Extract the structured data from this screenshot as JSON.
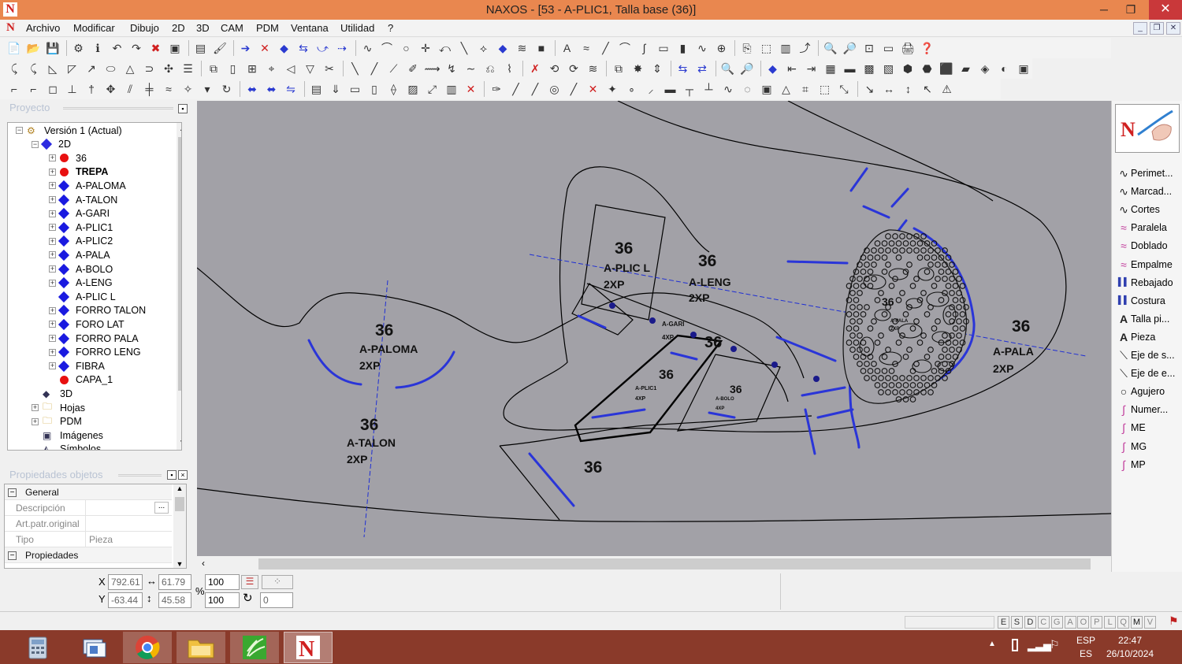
{
  "window": {
    "title": "NAXOS - [53 - A-PLIC1, Talla base (36)]",
    "logo_glyph": "N"
  },
  "menu": [
    "Archivo",
    "Modificar",
    "Dibujo",
    "2D",
    "3D",
    "CAM",
    "PDM",
    "Ventana",
    "Utilidad",
    "?"
  ],
  "panels": {
    "project_title": "Proyecto",
    "props_title": "Propiedades objetos"
  },
  "tree": [
    {
      "label": "Versión 1 (Actual)",
      "icon": "version-icon",
      "exp": "−"
    },
    {
      "label": "2D",
      "icon": "diamond-icon",
      "color": "#2d2be0",
      "exp": "−"
    },
    {
      "label": "36",
      "icon": "dot-icon",
      "color": "#e81010",
      "exp": "+"
    },
    {
      "label": "TREPA",
      "icon": "dot-icon",
      "color": "#e81010",
      "exp": "+",
      "bold": true
    },
    {
      "label": "A-PALOMA",
      "icon": "diamond-icon",
      "color": "#1a1ae0",
      "exp": "+"
    },
    {
      "label": "A-TALON",
      "icon": "diamond-icon",
      "color": "#1a1ae0",
      "exp": "+"
    },
    {
      "label": "A-GARI",
      "icon": "diamond-icon",
      "color": "#1a1ae0",
      "exp": "+"
    },
    {
      "label": "A-PLIC1",
      "icon": "diamond-icon",
      "color": "#1a1ae0",
      "exp": "+"
    },
    {
      "label": "A-PLIC2",
      "icon": "diamond-icon",
      "color": "#1a1ae0",
      "exp": "+"
    },
    {
      "label": "A-PALA",
      "icon": "diamond-icon",
      "color": "#1a1ae0",
      "exp": "+"
    },
    {
      "label": "A-BOLO",
      "icon": "diamond-icon",
      "color": "#1a1ae0",
      "exp": "+"
    },
    {
      "label": "A-LENG",
      "icon": "diamond-icon",
      "color": "#1a1ae0",
      "exp": "+"
    },
    {
      "label": "A-PLIC L",
      "icon": "diamond-icon",
      "color": "#1a1ae0",
      "exp": ""
    },
    {
      "label": "FORRO TALON",
      "icon": "diamond-icon",
      "color": "#1a1ae0",
      "exp": "+"
    },
    {
      "label": "FORO LAT",
      "icon": "diamond-icon",
      "color": "#1a1ae0",
      "exp": "+"
    },
    {
      "label": "FORRO PALA",
      "icon": "diamond-icon",
      "color": "#1a1ae0",
      "exp": "+"
    },
    {
      "label": "FORRO LENG",
      "icon": "diamond-icon",
      "color": "#1a1ae0",
      "exp": "+"
    },
    {
      "label": "FIBRA",
      "icon": "diamond-icon",
      "color": "#1a1ae0",
      "exp": "+"
    },
    {
      "label": "CAPA_1",
      "icon": "dot-icon",
      "color": "#e81010",
      "exp": ""
    },
    {
      "label": "3D",
      "icon": "3d-icon",
      "exp": ""
    },
    {
      "label": "Hojas",
      "icon": "folder-icon",
      "exp": "+"
    },
    {
      "label": "PDM",
      "icon": "folder-icon",
      "exp": "+"
    },
    {
      "label": "Imágenes",
      "icon": "image-icon",
      "exp": ""
    },
    {
      "label": "Símbolos",
      "icon": "symbol-icon",
      "exp": ""
    }
  ],
  "properties": {
    "general_label": "General",
    "rows": [
      {
        "label": "Descripción",
        "value": ""
      },
      {
        "label": "Art.patr.original",
        "value": ""
      },
      {
        "label": "Tipo",
        "value": "Pieza"
      }
    ],
    "props_label": "Propiedades"
  },
  "tools": [
    {
      "label": "Perimet...",
      "icon": "curve-icon"
    },
    {
      "label": "Marcad...",
      "icon": "curve-icon"
    },
    {
      "label": "Cortes",
      "icon": "curve-icon"
    },
    {
      "label": "Paralela",
      "icon": "parallel-icon"
    },
    {
      "label": "Doblado",
      "icon": "parallel-icon"
    },
    {
      "label": "Empalme",
      "icon": "parallel-icon"
    },
    {
      "label": "Rebajado",
      "icon": "bars-icon"
    },
    {
      "label": "Costura",
      "icon": "bars-icon"
    },
    {
      "label": "Talla pi...",
      "icon": "text-a-icon"
    },
    {
      "label": "Pieza",
      "icon": "text-a-icon"
    },
    {
      "label": "Eje de s...",
      "icon": "axis-icon"
    },
    {
      "label": "Eje de e...",
      "icon": "axis-icon"
    },
    {
      "label": "Agujero",
      "icon": "circle-icon"
    },
    {
      "label": "Numer...",
      "icon": "pen-icon"
    },
    {
      "label": "ME",
      "icon": "pen-icon"
    },
    {
      "label": "MG",
      "icon": "pen-icon"
    },
    {
      "label": "MP",
      "icon": "pen-icon"
    }
  ],
  "coords": {
    "x_label": "X",
    "y_label": "Y",
    "x": "792.61",
    "y": "-63.44",
    "w": "61.79",
    "h": "45.58",
    "sx": "100",
    "sy": "100",
    "rot": "0",
    "pct": "%"
  },
  "status_letters": [
    "E",
    "S",
    "D",
    "C",
    "G",
    "A",
    "O",
    "P",
    "L",
    "Q",
    "M",
    "V"
  ],
  "drawing_labels": {
    "size": "36",
    "paloma": "A-PALOMA",
    "talon": "A-TALON",
    "plicl": "A-PLIC L",
    "leng": "A-LENG",
    "pala": "A-PALA",
    "gari": "A-GARI",
    "plic1": "A-PLIC1",
    "bolo": "A-BOLO",
    "qty2": "2XP",
    "qty4": "4XP"
  },
  "tray": {
    "lang_top": "ESP",
    "lang_bottom": "ES",
    "time": "22:47",
    "date": "26/10/2024"
  }
}
